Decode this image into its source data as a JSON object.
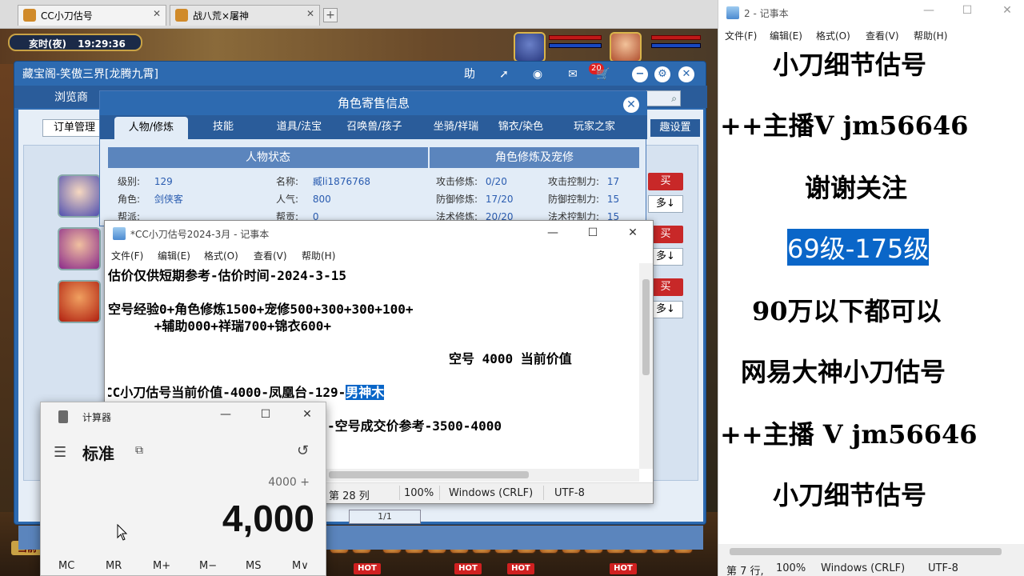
{
  "browser_tabs": [
    {
      "label": "CC小刀估号"
    },
    {
      "label": "战八荒×屠神"
    }
  ],
  "game": {
    "clock_period": "亥时(夜)",
    "clock_time": "19:29:36",
    "hot_label": "HOT",
    "current_label": "当前"
  },
  "cbg": {
    "title": "藏宝阁-笑傲三界[龙腾九霄]",
    "help": "助",
    "notif_count": "20",
    "browse_tab": "浏览商",
    "order_mgmt": "订单管理",
    "setting_tab": "趣设置",
    "buy_label": "买",
    "more_label": "多↓",
    "page_indicator": "1/1"
  },
  "dialog": {
    "title": "角色寄售信息",
    "tabs": [
      "人物/修炼",
      "技能",
      "道具/法宝",
      "召唤兽/孩子",
      "坐骑/祥瑞",
      "锦衣/染色",
      "玩家之家"
    ],
    "left_header": "人物状态",
    "right_header": "角色修炼及宠修",
    "level_label": "级别:",
    "level_value": "129",
    "role_label": "角色:",
    "role_value": "剑侠客",
    "gang_label": "帮派:",
    "name_label": "名称:",
    "name_value": "臧li1876768",
    "pop_label": "人气:",
    "pop_value": "800",
    "gangcoin_label": "帮贡:",
    "gangcoin_value": "0",
    "atk_label": "攻击修炼:",
    "atk_value": "0/20",
    "def_label": "防御修炼:",
    "def_value": "17/20",
    "mag_label": "法术修炼:",
    "mag_value": "20/20",
    "atkctl_label": "攻击控制力:",
    "atkctl_value": "17",
    "defctl_label": "防御控制力:",
    "defctl_value": "15",
    "magctl_label": "法术控制力:",
    "magctl_value": "15"
  },
  "notepad1": {
    "title": "*CC小刀估号2024-3月 - 记事本",
    "menu": [
      "文件(F)",
      "编辑(E)",
      "格式(O)",
      "查看(V)",
      "帮助(H)"
    ],
    "line1": "估价仅供短期参考-估价时间-2024-3-15",
    "line2": "空号经验0+角色修炼1500+宠修500+300+300+100+",
    "line3": "      +辅助000+祥瑞700+锦衣600+",
    "line4": "空号 4000 当前价值",
    "line5_pre": "CC小刀估号当前价值-4000-凤凰台-129-",
    "line5_sel": "男神木",
    "line6": "-空号成交价参考-3500-4000",
    "status_pos": "第 28 列",
    "status_zoom": "100%",
    "status_eol": "Windows (CRLF)",
    "status_enc": "UTF-8"
  },
  "calculator": {
    "title": "计算器",
    "mode": "标准",
    "expression": "4000 +",
    "display": "4,000",
    "memory": [
      "MC",
      "MR",
      "M+",
      "M−",
      "MS",
      "M∨"
    ]
  },
  "notepad2": {
    "title": "2 - 记事本",
    "menu": [
      "文件(F)",
      "编辑(E)",
      "格式(O)",
      "查看(V)",
      "帮助(H)"
    ],
    "lines": [
      "小刀细节估号",
      "++主播V jm56646",
      "谢谢关注",
      "69级-175级",
      "90万以下都可以",
      "网易大神小刀估号",
      "++主播 V jm56646",
      "小刀细节估号"
    ],
    "status_pos": "第 7 行,",
    "status_zoom": "100%",
    "status_eol": "Windows (CRLF)",
    "status_enc": "UTF-8"
  },
  "colors": {
    "accent": "#2d6ab0",
    "selection": "#0a66c8",
    "buy": "#c82828"
  }
}
